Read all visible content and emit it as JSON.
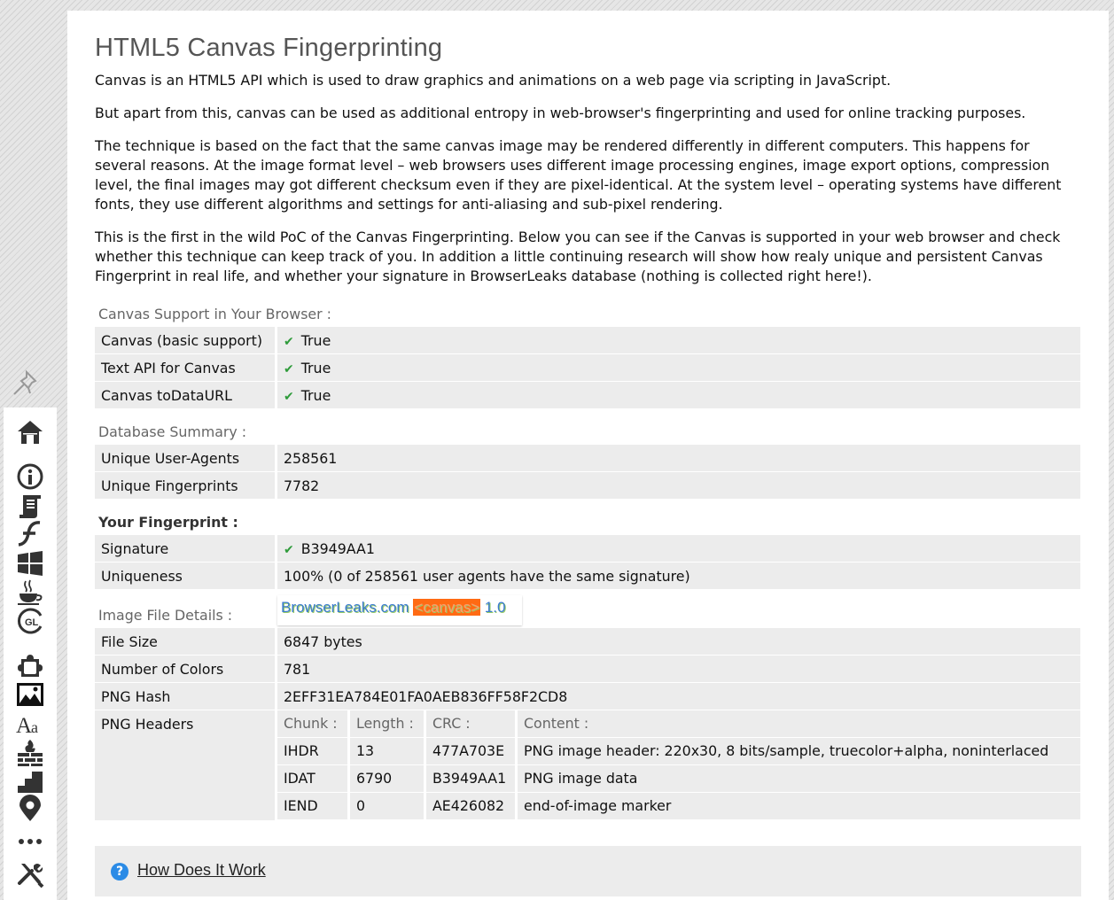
{
  "title": "HTML5 Canvas Fingerprinting",
  "paragraphs": [
    "Canvas is an HTML5 API which is used to draw graphics and animations on a web page via scripting in JavaScript.",
    "But apart from this, canvas can be used as additional entropy in web-browser's fingerprinting and used for online tracking purposes.",
    "The technique is based on the fact that the same canvas image may be rendered differently in different computers. This happens for several reasons. At the image format level – web browsers uses different image processing engines, image export options, compression level, the final images may got different checksum even if they are pixel-identical. At the system level – operating systems have different fonts, they use different algorithms and settings for anti-aliasing and sub-pixel rendering.",
    "This is the first in the wild PoC of the Canvas Fingerprinting. Below you can see if the Canvas is supported in your web browser and check whether this technique can keep track of you. In addition a little continuing research will show how realy unique and persistent Canvas Fingerprint in real life, and whether your signature in BrowserLeaks database (nothing is collected right here!)."
  ],
  "support": {
    "heading": "Canvas Support in Your Browser :",
    "rows": [
      {
        "key": "Canvas (basic support)",
        "value": "True"
      },
      {
        "key": "Text API for Canvas",
        "value": "True"
      },
      {
        "key": "Canvas toDataURL",
        "value": "True"
      }
    ]
  },
  "database": {
    "heading": "Database Summary :",
    "rows": [
      {
        "key": "Unique User-Agents",
        "value": "258561"
      },
      {
        "key": "Unique Fingerprints",
        "value": "7782"
      }
    ]
  },
  "fingerprint": {
    "heading": "Your Fingerprint :",
    "signature_key": "Signature",
    "signature_value": "B3949AA1",
    "uniqueness_key": "Uniqueness",
    "uniqueness_value": "100% (0 of 258561 user agents have the same signature)"
  },
  "image_file": {
    "heading": "Image File Details :",
    "canvas_text_a": "BrowserLeaks.com",
    "canvas_text_b": "<canvas>",
    "canvas_text_c": "1.0",
    "rows": [
      {
        "key": "File Size",
        "value": "6847 bytes"
      },
      {
        "key": "Number of Colors",
        "value": "781"
      },
      {
        "key": "PNG Hash",
        "value": "2EFF31EA784E01FA0AEB836FF58F2CD8"
      }
    ],
    "png_headers_key": "PNG Headers",
    "png_columns": [
      "Chunk :",
      "Length :",
      "CRC :",
      "Content :"
    ],
    "png_rows": [
      [
        "IHDR",
        "13",
        "477A703E",
        "PNG image header: 220x30, 8 bits/sample, truecolor+alpha, noninterlaced"
      ],
      [
        "IDAT",
        "6790",
        "B3949AA1",
        "PNG image data"
      ],
      [
        "IEND",
        "0",
        "AE426082",
        "end-of-image marker"
      ]
    ]
  },
  "how_link": "How Does It Work",
  "sidebar_icons": [
    "home-icon",
    "info-icon",
    "script-icon",
    "flash-icon",
    "windows-icon",
    "java-icon",
    "webgl-icon",
    "puzzle-icon",
    "image-icon",
    "font-icon",
    "firewall-icon",
    "stairs-icon",
    "location-icon",
    "more-icon",
    "tools-icon"
  ],
  "colors": {
    "check": "#2e9b3a",
    "accent": "#2b8be6",
    "row_bg": "#ececec"
  }
}
